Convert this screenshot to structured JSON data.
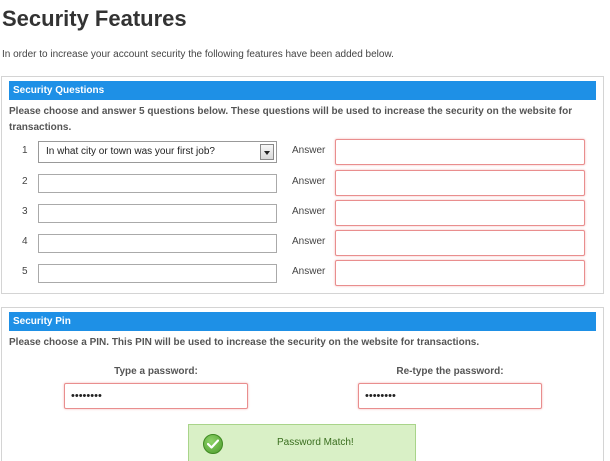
{
  "page": {
    "title": "Security Features",
    "intro": "In order to increase your account security the following features have been added below."
  },
  "security_questions": {
    "header": "Security Questions",
    "description": "Please choose and answer 5 questions below. These questions will be used to increase the security on the website for transactions.",
    "answer_label": "Answer",
    "rows": [
      {
        "number": "1",
        "question": "In what city or town was your first job?"
      },
      {
        "number": "2",
        "question": ""
      },
      {
        "number": "3",
        "question": ""
      },
      {
        "number": "4",
        "question": ""
      },
      {
        "number": "5",
        "question": ""
      }
    ]
  },
  "security_pin": {
    "header": "Security Pin",
    "description": "Please choose a PIN. This PIN will be used to increase the security on the website for transactions.",
    "password_label": "Type a password:",
    "password_value": "••••••••",
    "retype_label": "Re-type the password:",
    "retype_value": "••••••••",
    "match_message": "Password Match!",
    "match_icon": "check-circle-icon"
  },
  "colors": {
    "header_blue": "#1e90e6",
    "error_border": "#e98e8e",
    "success_bg": "#d9f0c6",
    "success_icon": "#4a9a2a"
  }
}
